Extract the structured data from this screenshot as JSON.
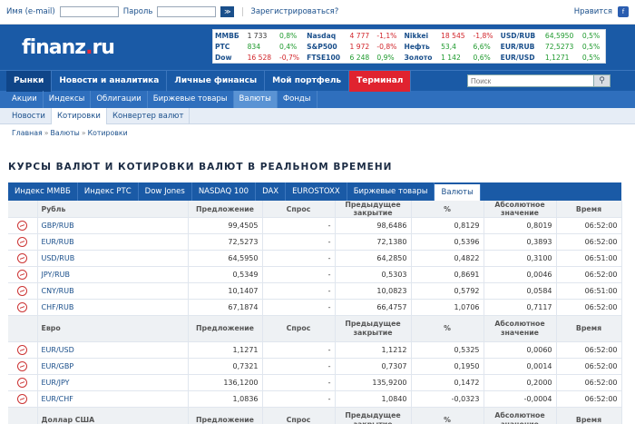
{
  "topbar": {
    "login_label": "Имя (e-mail)",
    "password_label": "Пароль",
    "go_label": "≫",
    "register": "Зарегистрироваться?",
    "like_label": "Нравится",
    "fb_icon": "f"
  },
  "logo": {
    "left": "finanz",
    "mid": ".",
    "right": "ru"
  },
  "tickers": [
    [
      {
        "n": "ММВБ"
      },
      {
        "v": "1 733"
      },
      {
        "c": "0,8%",
        "s": "up"
      },
      {
        "n": "Nasdaq"
      },
      {
        "v": "4 777",
        "s": "dn"
      },
      {
        "c": "-1,1%",
        "s": "dn"
      },
      {
        "n": "Nikkei"
      },
      {
        "v": "18 545",
        "s": "dn"
      },
      {
        "c": "-1,8%",
        "s": "dn"
      },
      {
        "n": "USD/RUB"
      },
      {
        "v": "64,5950",
        "s": "up"
      },
      {
        "c": "0,5%",
        "s": "up"
      }
    ],
    [
      {
        "n": "РТС"
      },
      {
        "v": "834",
        "s": "up"
      },
      {
        "c": "0,4%",
        "s": "up"
      },
      {
        "n": "S&P500"
      },
      {
        "v": "1 972",
        "s": "dn"
      },
      {
        "c": "-0,8%",
        "s": "dn"
      },
      {
        "n": "Нефть"
      },
      {
        "v": "53,4",
        "s": "up"
      },
      {
        "c": "6,6%",
        "s": "up"
      },
      {
        "n": "EUR/RUB"
      },
      {
        "v": "72,5273",
        "s": "up"
      },
      {
        "c": "0,5%",
        "s": "up"
      }
    ],
    [
      {
        "n": "Dow"
      },
      {
        "v": "16 528",
        "s": "dn"
      },
      {
        "c": "-0,7%",
        "s": "dn"
      },
      {
        "n": "FTSE100"
      },
      {
        "v": "6 248",
        "s": "up"
      },
      {
        "c": "0,9%",
        "s": "up"
      },
      {
        "n": "Золото"
      },
      {
        "v": "1 142",
        "s": "up"
      },
      {
        "c": "0,6%",
        "s": "up"
      },
      {
        "n": "EUR/USD"
      },
      {
        "v": "1,1271",
        "s": "up"
      },
      {
        "c": "0,5%",
        "s": "up"
      }
    ]
  ],
  "nav1": [
    "Рынки",
    "Новости и аналитика",
    "Личные финансы",
    "Мой портфель",
    "Терминал"
  ],
  "search": {
    "placeholder": "Поиск"
  },
  "nav2": [
    "Акции",
    "Индексы",
    "Облигации",
    "Биржевые товары",
    "Валюты",
    "Фонды"
  ],
  "nav3": [
    "Новости",
    "Котировки",
    "Конвертер валют"
  ],
  "breadcrumb": [
    "Главная",
    "Валюты",
    "Котировки"
  ],
  "page_title": "КУРСЫ ВАЛЮТ И КОТИРОВКИ ВАЛЮТ В РЕАЛЬНОМ ВРЕМЕНИ",
  "tabs": [
    "Индекс ММВБ",
    "Индекс РТС",
    "Dow Jones",
    "NASDAQ 100",
    "DAX",
    "EUROSTOXX",
    "Биржевые товары",
    "Валюты"
  ],
  "columns": [
    "Предложение",
    "Спрос",
    "Предыдущее закрытие",
    "%",
    "Абсолютное значение",
    "Время"
  ],
  "groups": [
    {
      "name": "Рубль",
      "rows": [
        [
          "GBP/RUB",
          "99,4505",
          "-",
          "98,6486",
          "0,8129",
          "0,8019",
          "06:52:00"
        ],
        [
          "EUR/RUB",
          "72,5273",
          "-",
          "72,1380",
          "0,5396",
          "0,3893",
          "06:52:00"
        ],
        [
          "USD/RUB",
          "64,5950",
          "-",
          "64,2850",
          "0,4822",
          "0,3100",
          "06:51:00"
        ],
        [
          "JPY/RUB",
          "0,5349",
          "-",
          "0,5303",
          "0,8691",
          "0,0046",
          "06:52:00"
        ],
        [
          "CNY/RUB",
          "10,1407",
          "-",
          "10,0823",
          "0,5792",
          "0,0584",
          "06:51:00"
        ],
        [
          "CHF/RUB",
          "67,1874",
          "-",
          "66,4757",
          "1,0706",
          "0,7117",
          "06:52:00"
        ]
      ]
    },
    {
      "name": "Евро",
      "rows": [
        [
          "EUR/USD",
          "1,1271",
          "-",
          "1,1212",
          "0,5325",
          "0,0060",
          "06:52:00"
        ],
        [
          "EUR/GBP",
          "0,7321",
          "-",
          "0,7307",
          "0,1950",
          "0,0014",
          "06:52:00"
        ],
        [
          "EUR/JPY",
          "136,1200",
          "-",
          "135,9200",
          "0,1472",
          "0,2000",
          "06:52:00"
        ],
        [
          "EUR/CHF",
          "1,0836",
          "-",
          "1,0840",
          "-0,0323",
          "-0,0004",
          "06:52:00"
        ]
      ]
    },
    {
      "name": "Доллар США",
      "rows": []
    }
  ]
}
